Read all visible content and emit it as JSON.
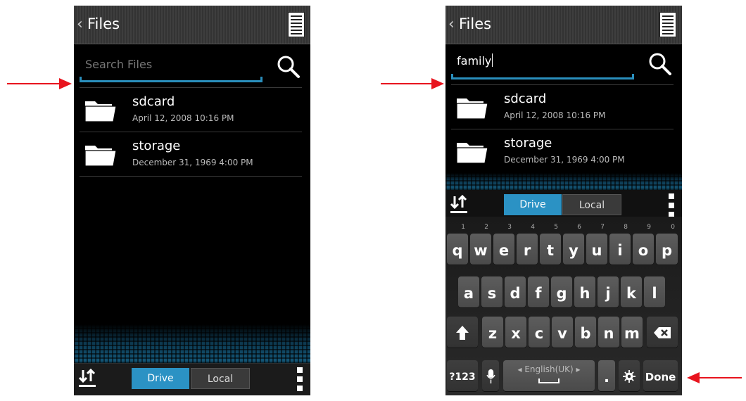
{
  "left_screen": {
    "header": {
      "title": "Files"
    },
    "search": {
      "placeholder": "Search Files",
      "value": ""
    },
    "files": [
      {
        "name": "sdcard",
        "date": "April 12, 2008 10:16 PM"
      },
      {
        "name": "storage",
        "date": "December 31, 1969 4:00 PM"
      }
    ],
    "bottom_bar": {
      "drive_label": "Drive",
      "local_label": "Local"
    }
  },
  "right_screen": {
    "header": {
      "title": "Files"
    },
    "search": {
      "value": "family"
    },
    "files": [
      {
        "name": "sdcard",
        "date": "April 12, 2008 10:16 PM"
      },
      {
        "name": "storage",
        "date": "December 31, 1969 4:00 PM"
      }
    ],
    "bottom_bar": {
      "drive_label": "Drive",
      "local_label": "Local"
    },
    "keyboard": {
      "row1": [
        "q",
        "w",
        "e",
        "r",
        "t",
        "y",
        "u",
        "i",
        "o",
        "p"
      ],
      "row1_hints": [
        "1",
        "2",
        "3",
        "4",
        "5",
        "6",
        "7",
        "8",
        "9",
        "0"
      ],
      "row2": [
        "a",
        "s",
        "d",
        "f",
        "g",
        "h",
        "j",
        "k",
        "l"
      ],
      "row3": [
        "z",
        "x",
        "c",
        "v",
        "b",
        "n",
        "m"
      ],
      "symbols_label": "?123",
      "space_label": "English(UK)",
      "period_label": ".",
      "done_label": "Done"
    }
  },
  "colors": {
    "accent": "#2b92c4",
    "arrow": "#e8141e"
  }
}
